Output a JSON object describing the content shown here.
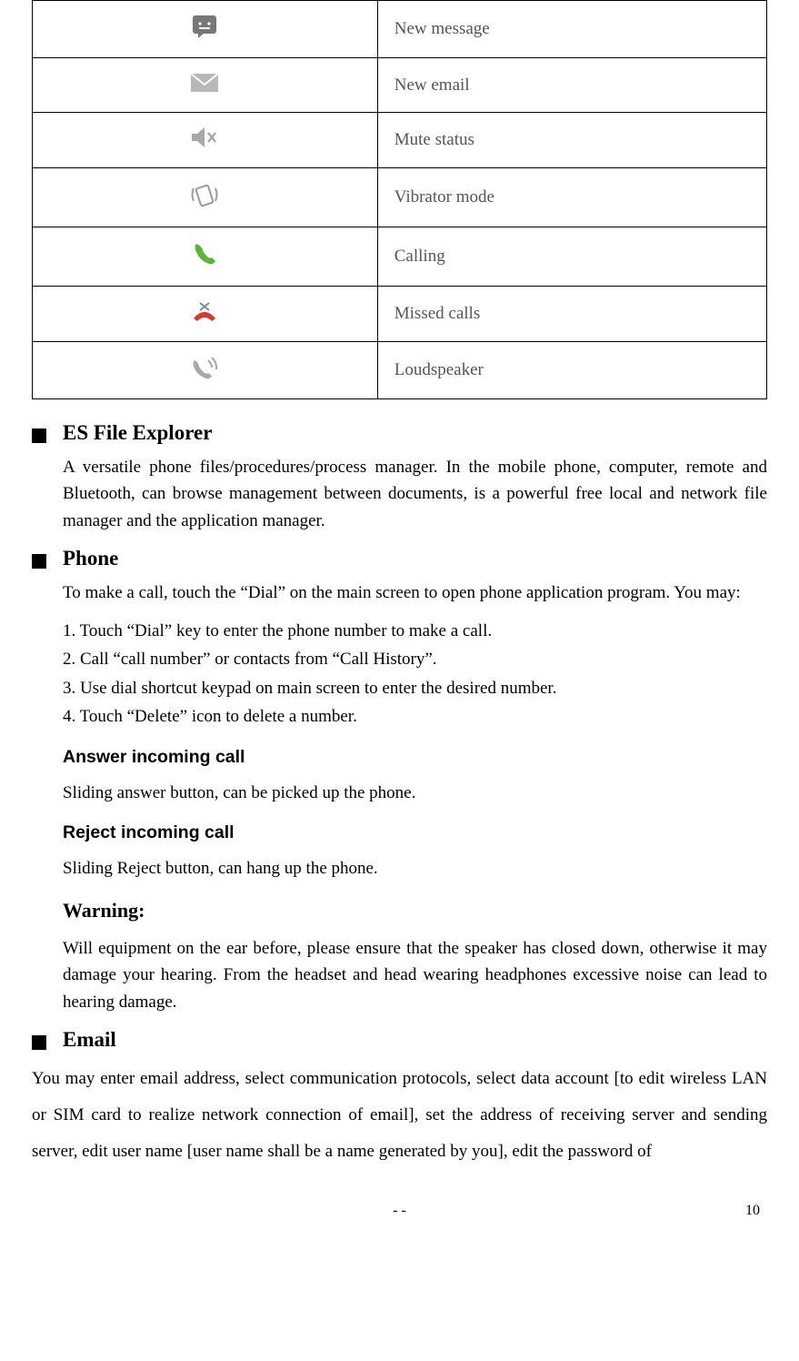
{
  "icon_table": [
    {
      "icon": "message",
      "label": "New message"
    },
    {
      "icon": "email",
      "label": "New email"
    },
    {
      "icon": "mute",
      "label": "Mute status"
    },
    {
      "icon": "vibrate",
      "label": "Vibrator mode"
    },
    {
      "icon": "calling",
      "label": "Calling"
    },
    {
      "icon": "missed",
      "label": "Missed calls"
    },
    {
      "icon": "loudspeaker",
      "label": "Loudspeaker"
    }
  ],
  "sections": {
    "es": {
      "title": "ES File Explorer",
      "body": "A versatile phone files/procedures/process manager. In the mobile phone, computer, remote and Bluetooth, can browse management between documents, is a powerful free local and network file manager and the application manager."
    },
    "phone": {
      "title": "Phone",
      "intro": "To make a call, touch the “Dial” on the main screen to open phone application program. You may:",
      "step1": "1. Touch “Dial” key to enter the phone number to make a call.",
      "step2": "2. Call “call number” or contacts from “Call History”.",
      "step3": "3. Use dial shortcut keypad on main screen to enter the desired number.",
      "step4": "4. Touch “Delete” icon to delete a number.",
      "answer_h": "Answer incoming call",
      "answer_b": "Sliding answer button, can be picked up the phone.",
      "reject_h": "Reject incoming call",
      "reject_b": "Sliding Reject button, can hang up the phone.",
      "warn_h": "Warning:",
      "warn_b": "Will equipment on the ear before, please ensure that the speaker has closed down, otherwise it may damage your hearing. From the headset and head wearing headphones excessive noise can lead to hearing damage."
    },
    "email": {
      "title": "Email",
      "body": "You may enter email address, select communication protocols, select data account [to edit wireless LAN or SIM card to realize network connection of email], set the address of receiving server and sending server, edit user name [user name shall be a name generated by you], edit the password of"
    }
  },
  "footer": {
    "dash": "-   -",
    "page": "10"
  }
}
